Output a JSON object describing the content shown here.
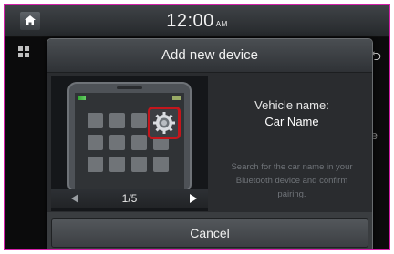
{
  "status_bar": {
    "time": "12:00",
    "ampm": "AM"
  },
  "background": {
    "partial_text": "le"
  },
  "dialog": {
    "title": "Add new device",
    "vehicle_name_label": "Vehicle name:",
    "vehicle_name_value": "Car Name",
    "instruction": "Search for the car name in your Bluetooth device and confirm pairing.",
    "pager": {
      "current_page": "1/5"
    },
    "cancel_label": "Cancel"
  },
  "colors": {
    "highlight": "#c4161c",
    "frame_border": "#d21fa8"
  },
  "icons": [
    "home-icon",
    "grid-icon",
    "back-icon",
    "settings-gear-icon",
    "prev-arrow-icon",
    "next-arrow-icon"
  ]
}
